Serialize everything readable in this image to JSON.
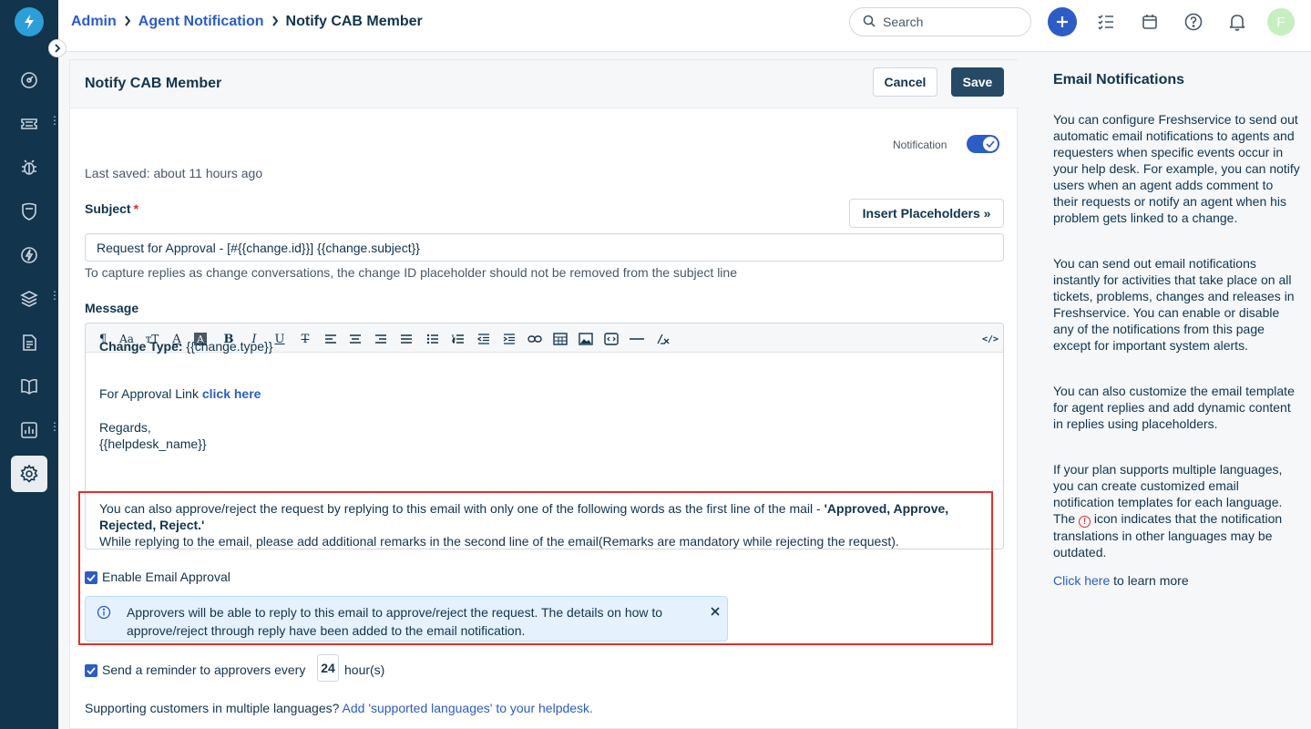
{
  "breadcrumb": {
    "items": [
      "Admin",
      "Agent Notification"
    ],
    "current": "Notify CAB Member"
  },
  "search": {
    "placeholder": "Search"
  },
  "user": {
    "avatar_initial": "F"
  },
  "page": {
    "title": "Notify CAB Member",
    "cancel_label": "Cancel",
    "save_label": "Save",
    "notification_label": "Notification",
    "notification_enabled": true,
    "last_saved": "Last saved: about 11 hours ago"
  },
  "subject": {
    "label": "Subject",
    "required_mark": "*",
    "insert_placeholders_label": "Insert Placeholders »",
    "value": "Request for Approval - [#{{change.id}}] {{change.subject}}",
    "hint": "To capture replies as change conversations, the change ID placeholder should not be removed from the subject line"
  },
  "message": {
    "label": "Message",
    "toolbar_icons": [
      "paragraph-icon",
      "font-size-icon",
      "text-transform-icon",
      "font-color-icon",
      "background-color-icon",
      "bold-icon",
      "italic-icon",
      "underline-icon",
      "strikethrough-icon",
      "align-left-icon",
      "align-center-icon",
      "align-right-icon",
      "justify-icon",
      "bullet-list-icon",
      "numbered-list-icon",
      "outdent-icon",
      "indent-icon",
      "link-icon",
      "table-icon",
      "image-icon",
      "code-block-icon",
      "horizontal-rule-icon",
      "clear-format-icon",
      "source-code-icon"
    ],
    "change_type_label": "Change Type:",
    "change_type_value": "{{change.type}}",
    "approval_link_prefix": "For Approval Link",
    "approval_link_text": "click here",
    "regards": "Regards,",
    "helpdesk_name": "{{helpdesk_name}}",
    "approve_line_prefix": "You can also approve/reject the request by replying to this email with only one of the following words as the first line of the mail - ",
    "approve_words": "'Approved, Approve, Rejected, Reject.'",
    "remarks_line": "While replying to the email, please add additional remarks in the second line of the email(Remarks are mandatory while rejecting the request)."
  },
  "email_approval": {
    "checkbox_label": "Enable Email Approval",
    "checked": true,
    "info_text": "Approvers will be able to reply to this email to approve/reject the request. The details on how to approve/reject through reply have been added to the email notification."
  },
  "reminder": {
    "checked": true,
    "prefix": "Send a reminder to approvers every",
    "hours": "24",
    "suffix": "hour(s)"
  },
  "languages": {
    "text": "Supporting customers in multiple languages?",
    "link": "Add 'supported languages' to your helpdesk."
  },
  "side_panel": {
    "title": "Email Notifications",
    "p1": "You can configure Freshservice to send out automatic email notifications to agents and requesters when specific events occur in your help desk. For example, you can notify users when an agent adds comment to their requests or notify an agent when his problem gets linked to a change.",
    "p2": "You can send out email notifications instantly for activities that take place on all tickets, problems, changes and releases in Freshservice. You can enable or disable any of the notifications from this page except for important system alerts.",
    "p3": "You can also customize the email template for agent replies and add dynamic content in replies using placeholders.",
    "p4_before": "If your plan supports multiple languages, you can create customized email notification templates for each language. The",
    "p4_after": "icon indicates that the notification translations in other languages may be outdated.",
    "learn_link": "Click here",
    "learn_suffix": "to learn more"
  },
  "colors": {
    "sidebar": "#12344d",
    "primary": "#2c5cc5",
    "save_button": "#264966",
    "highlight": "#e0312f",
    "info_bg": "#e5f2fd"
  }
}
